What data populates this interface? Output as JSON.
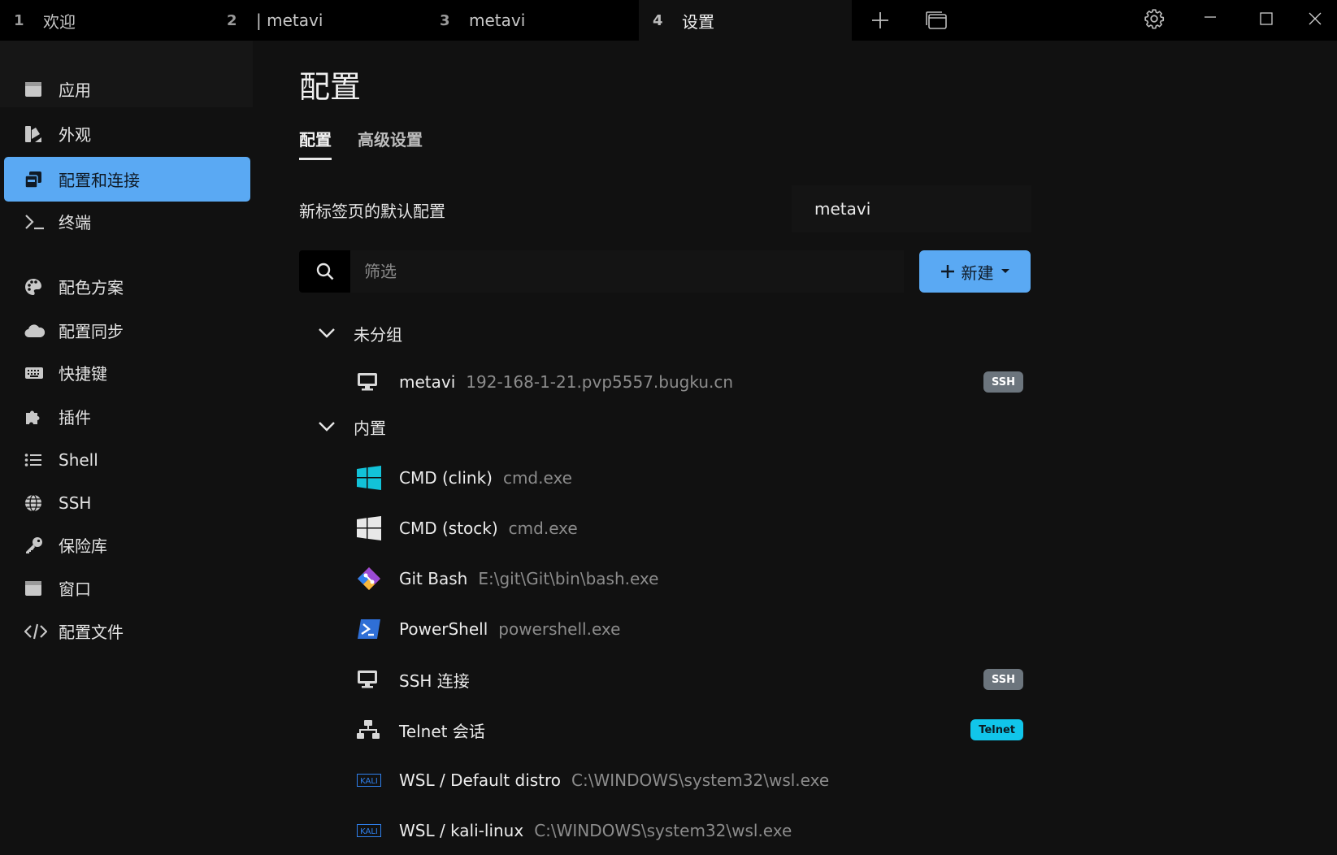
{
  "tabs": [
    {
      "num": "1",
      "label": "欢迎"
    },
    {
      "num": "2",
      "label": "| metavi"
    },
    {
      "num": "3",
      "label": "metavi"
    },
    {
      "num": "4",
      "label": "设置"
    }
  ],
  "sidebar": {
    "items": [
      {
        "label": "应用",
        "icon": "app-window-icon"
      },
      {
        "label": "外观",
        "icon": "paint-swatch-icon"
      },
      {
        "label": "配置和连接",
        "icon": "profiles-icon"
      },
      {
        "label": "终端",
        "icon": "terminal-prompt-icon"
      },
      {
        "label": "配色方案",
        "icon": "palette-icon"
      },
      {
        "label": "配置同步",
        "icon": "cloud-icon"
      },
      {
        "label": "快捷键",
        "icon": "keyboard-icon"
      },
      {
        "label": "插件",
        "icon": "puzzle-icon"
      },
      {
        "label": "Shell",
        "icon": "list-icon"
      },
      {
        "label": "SSH",
        "icon": "globe-icon"
      },
      {
        "label": "保险库",
        "icon": "key-icon"
      },
      {
        "label": "窗口",
        "icon": "window-icon"
      },
      {
        "label": "配置文件",
        "icon": "code-icon"
      }
    ],
    "active_label": "配置和连接"
  },
  "main": {
    "title": "配置",
    "subtabs": [
      "配置",
      "高级设置"
    ],
    "default_profile_label": "新标签页的默认配置",
    "default_profile_value": "metavi",
    "filter_placeholder": "筛选",
    "new_button_label": "新建",
    "groups": [
      {
        "name": "未分组",
        "profiles": [
          {
            "name": "metavi",
            "desc": "192-168-1-21.pvp5557.bugku.cn",
            "icon": "monitor-icon",
            "badge": "SSH"
          }
        ]
      },
      {
        "name": "内置",
        "profiles": [
          {
            "name": "CMD (clink)",
            "desc": "cmd.exe",
            "icon": "windows-logo-cyan-icon",
            "badge": ""
          },
          {
            "name": "CMD (stock)",
            "desc": "cmd.exe",
            "icon": "windows-logo-white-icon",
            "badge": ""
          },
          {
            "name": "Git Bash",
            "desc": "E:\\git\\Git\\bin\\bash.exe",
            "icon": "git-logo-icon",
            "badge": ""
          },
          {
            "name": "PowerShell",
            "desc": "powershell.exe",
            "icon": "powershell-icon",
            "badge": ""
          },
          {
            "name": "SSH 连接",
            "desc": "",
            "icon": "monitor-icon",
            "badge": "SSH"
          },
          {
            "name": "Telnet 会话",
            "desc": "",
            "icon": "network-icon",
            "badge": "Telnet"
          },
          {
            "name": "WSL / Default distro",
            "desc": "C:\\WINDOWS\\system32\\wsl.exe",
            "icon": "kali-icon",
            "badge": ""
          },
          {
            "name": "WSL / kali-linux",
            "desc": "C:\\WINDOWS\\system32\\wsl.exe",
            "icon": "kali-icon",
            "badge": ""
          }
        ]
      }
    ]
  },
  "colors": {
    "accent": "#5aa9f3",
    "background": "#111111",
    "titlebar": "#000000",
    "ssh_badge": "#6c757d",
    "telnet_badge": "#11c5ea"
  }
}
